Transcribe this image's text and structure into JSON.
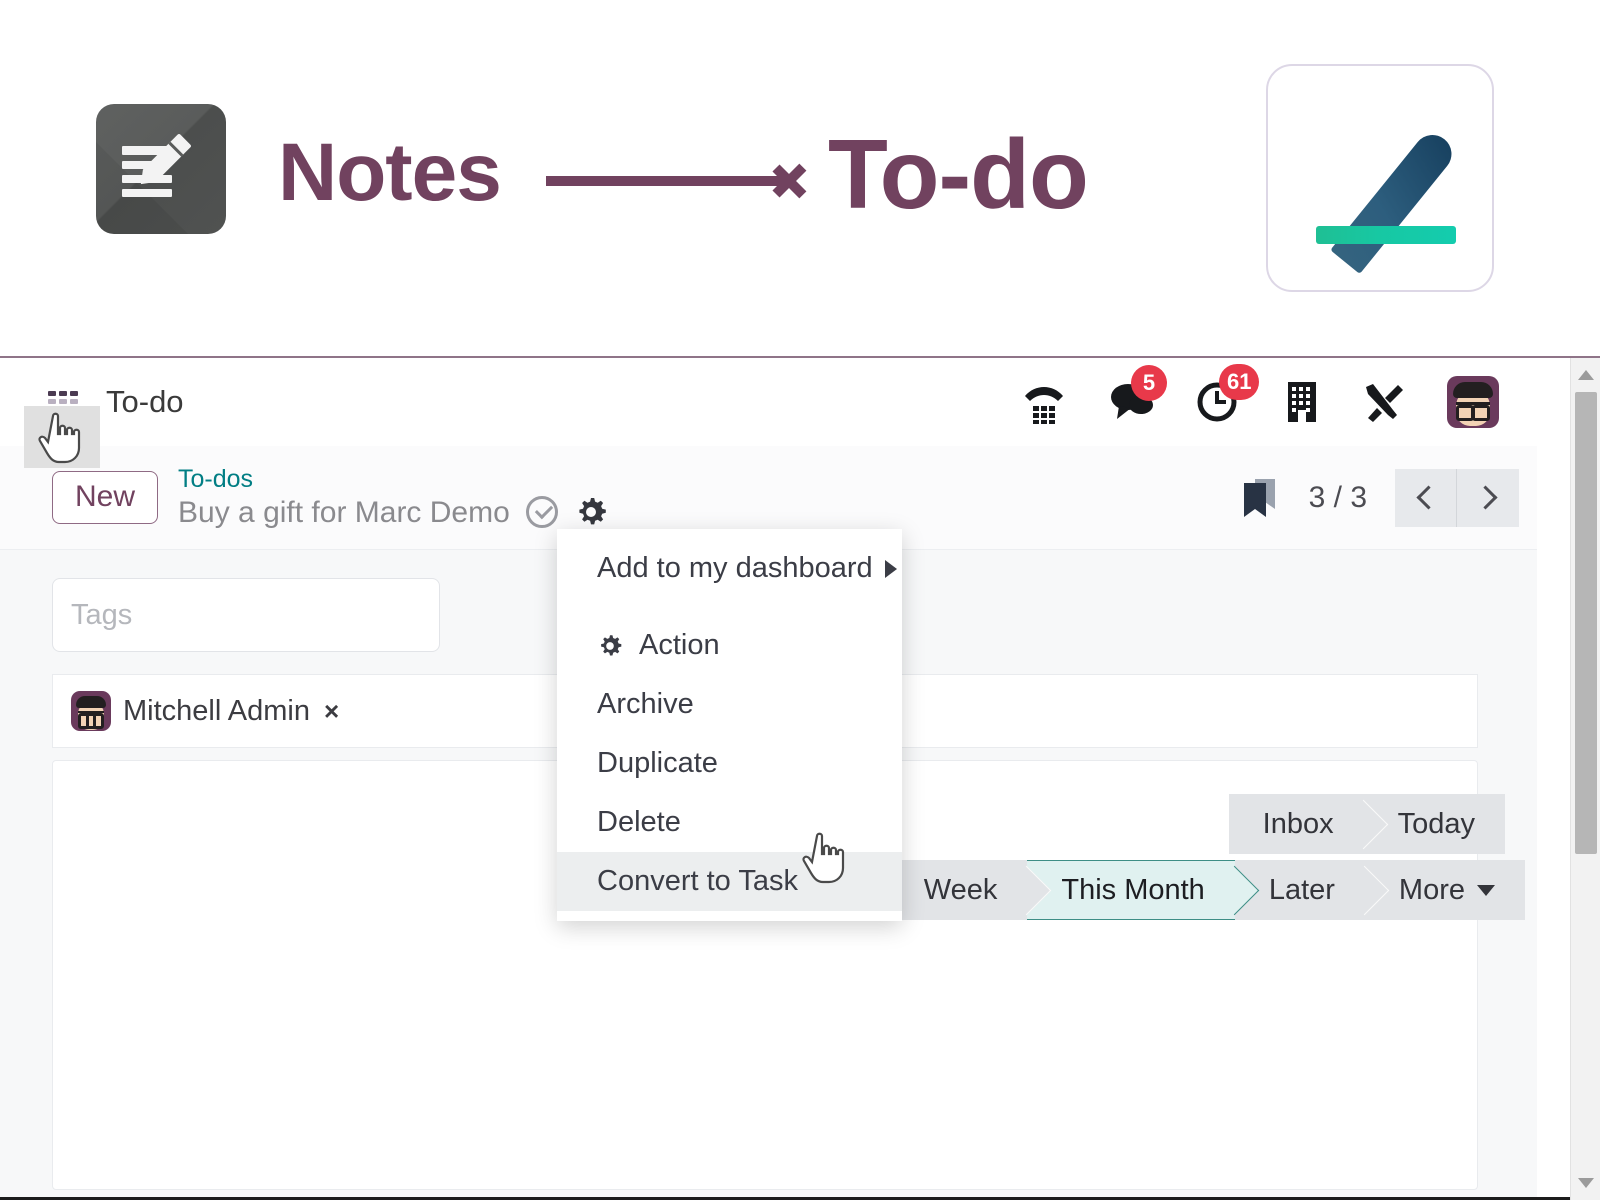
{
  "banner": {
    "from_label": "Notes",
    "to_label": "To-do",
    "arrow": "right-arrow",
    "old_icon_name": "notes-app-icon",
    "new_icon_name": "todo-app-icon",
    "accent_color": "#71425f"
  },
  "navbar": {
    "apps_menu_name": "apps-grid-icon",
    "app_title": "To-do",
    "icons": [
      {
        "name": "phone-dialpad-icon",
        "badge": null
      },
      {
        "name": "messages-icon",
        "badge": "5"
      },
      {
        "name": "activities-clock-icon",
        "badge": "61"
      },
      {
        "name": "company-building-icon",
        "badge": null
      },
      {
        "name": "developer-tools-icon",
        "badge": null
      }
    ],
    "badge_color": "#e8394a",
    "avatar_name": "Mitchell Admin"
  },
  "control_panel": {
    "new_button": "New",
    "breadcrumb_parent": "To-dos",
    "breadcrumb_current": "Buy a gift for Marc Demo",
    "done_toggle_name": "mark-as-done-icon",
    "settings_gear_name": "gear-icon",
    "bookmark_name": "bookmark-icon",
    "pager": "3 / 3",
    "prev_label": "Previous record",
    "next_label": "Next record"
  },
  "menu": {
    "items": [
      {
        "label": "Add to my dashboard",
        "submenu": true,
        "icon": null,
        "highlighted": false
      },
      {
        "label": "Action",
        "submenu": false,
        "icon": "gear-icon",
        "highlighted": false
      },
      {
        "label": "Archive",
        "submenu": false,
        "icon": null,
        "highlighted": false
      },
      {
        "label": "Duplicate",
        "submenu": false,
        "icon": null,
        "highlighted": false
      },
      {
        "label": "Delete",
        "submenu": false,
        "icon": null,
        "highlighted": false
      },
      {
        "label": "Convert to Task",
        "submenu": false,
        "icon": null,
        "highlighted": true
      }
    ]
  },
  "form": {
    "tags_placeholder": "Tags",
    "tags_value": "",
    "assignee": "Mitchell Admin",
    "assignee_remove": "×",
    "note_body": ""
  },
  "statusbar_top": {
    "pills": [
      {
        "label": "Inbox",
        "active": false,
        "caret": false
      },
      {
        "label": "Today",
        "active": false,
        "caret": false
      }
    ]
  },
  "statusbar_lower": {
    "pills": [
      {
        "label": "Week",
        "active": false,
        "caret": false
      },
      {
        "label": "This Month",
        "active": true,
        "caret": false
      },
      {
        "label": "Later",
        "active": false,
        "caret": false
      },
      {
        "label": "More",
        "active": false,
        "caret": true
      }
    ],
    "active_color": "#3e8e86",
    "active_bg": "#e0f1f0"
  },
  "cursors": {
    "apps_cursor": "hand-pointer-cursor",
    "menu_cursor": "hand-pointer-cursor"
  },
  "scrollbar": {
    "name": "vertical-scrollbar"
  }
}
